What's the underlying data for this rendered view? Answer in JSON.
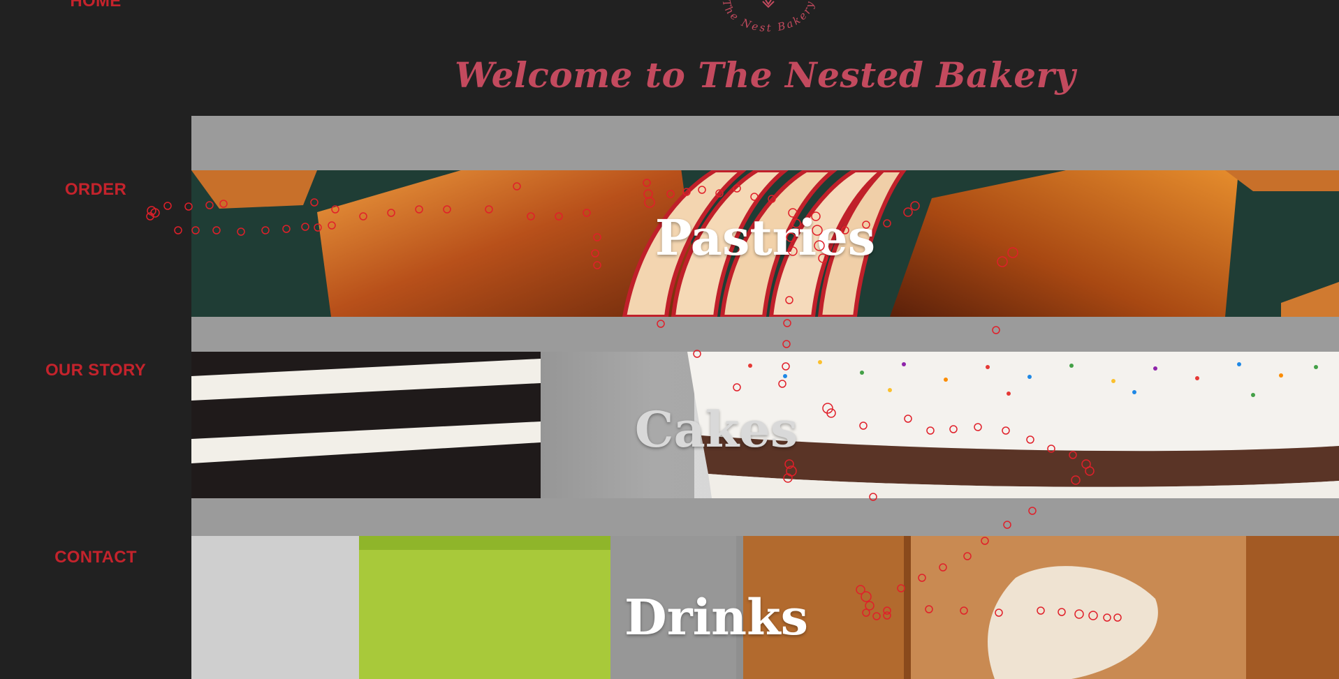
{
  "colors": {
    "accent": "#c4232c",
    "welcome": "#c34a5e",
    "background": "#212121",
    "gallery_bg": "#9b9b9b"
  },
  "nav": {
    "items": [
      {
        "label": "HOME"
      },
      {
        "label": "ORDER"
      },
      {
        "label": "OUR STORY"
      },
      {
        "label": "CONTACT"
      }
    ]
  },
  "header": {
    "logo_text": "The Nest Bakery",
    "welcome": "Welcome to The Nested Bakery"
  },
  "categories": [
    {
      "title": "Pastries",
      "image": "pastries-photo"
    },
    {
      "title": "Cakes",
      "image": "cakes-photo"
    },
    {
      "title": "Drinks",
      "image": "drinks-photo"
    }
  ]
}
